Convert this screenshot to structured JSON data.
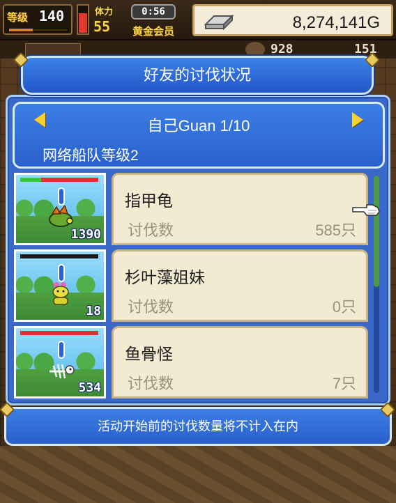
{
  "hud": {
    "level_label": "等级",
    "level": "140",
    "stamina_label": "体力",
    "stamina": "55",
    "timer": "0:56",
    "membership": "黄金会员",
    "gold": "8,274,141G",
    "stat_a": "928",
    "stat_b": "151"
  },
  "dialog": {
    "title": "好友的讨伐状况",
    "player_line": "自己Guan 1/10",
    "fleet_level": "网络船队等级2"
  },
  "monsters": [
    {
      "name": "指甲龟",
      "label": "讨伐数",
      "value": "585只",
      "count": "1390",
      "hp": 0.27
    },
    {
      "name": "杉叶藻姐妹",
      "label": "讨伐数",
      "value": "0只",
      "count": "18",
      "hp": 0
    },
    {
      "name": "鱼骨怪",
      "label": "讨伐数",
      "value": "7只",
      "count": "534",
      "hp": 1.0
    }
  ],
  "footer": {
    "note": "活动开始前的讨伐数量将不计入在内"
  },
  "colors": {
    "panel_blue": "#3a68c8",
    "card_cream": "#f3ead2",
    "accent_yellow": "#f5d030"
  },
  "icons": {
    "prev": "triangle-left-icon",
    "next": "triangle-right-icon",
    "pointer": "pointing-hand-icon",
    "gold": "silver-bar-icon"
  }
}
